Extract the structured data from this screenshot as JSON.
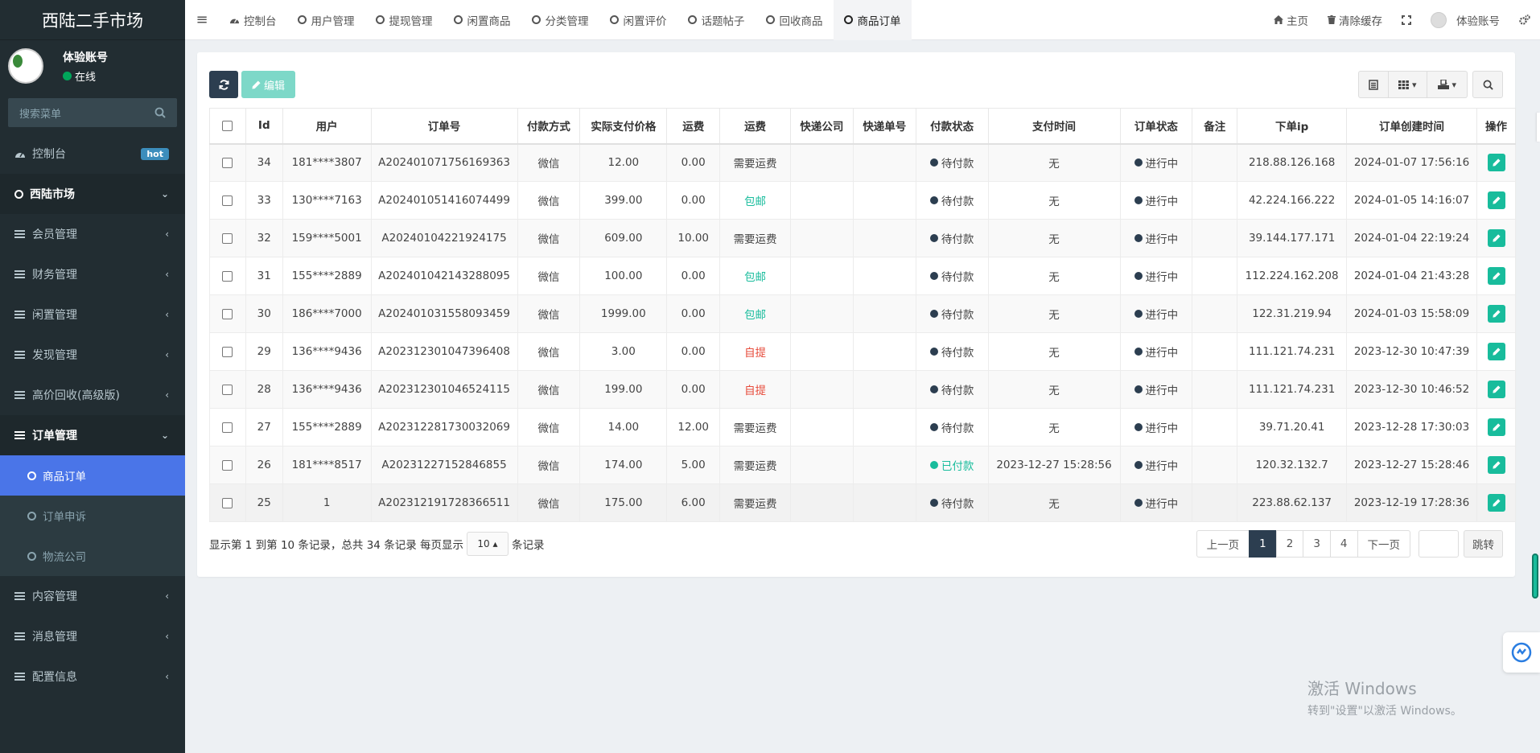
{
  "app_title": "西陆二手市场",
  "user": {
    "name": "体验账号",
    "status": "在线"
  },
  "sidebar": {
    "search_placeholder": "搜索菜单",
    "items": [
      {
        "label": "控制台",
        "badge": "hot"
      },
      {
        "label": "西陆市场"
      },
      {
        "label": "会员管理"
      },
      {
        "label": "财务管理"
      },
      {
        "label": "闲置管理"
      },
      {
        "label": "发现管理"
      },
      {
        "label": "高价回收(高级版)"
      },
      {
        "label": "订单管理"
      },
      {
        "label": "商品订单"
      },
      {
        "label": "订单申诉"
      },
      {
        "label": "物流公司"
      },
      {
        "label": "内容管理"
      },
      {
        "label": "消息管理"
      },
      {
        "label": "配置信息"
      }
    ]
  },
  "tabs": [
    "控制台",
    "用户管理",
    "提现管理",
    "闲置商品",
    "分类管理",
    "闲置评价",
    "话题帖子",
    "回收商品",
    "商品订单"
  ],
  "topbar_right": {
    "home": "主页",
    "clear_cache": "清除缓存",
    "account": "体验账号"
  },
  "toolbar": {
    "edit_label": "编辑"
  },
  "table": {
    "headers": [
      "Id",
      "用户",
      "订单号",
      "付款方式",
      "实际支付价格",
      "运费",
      "运费",
      "快递公司",
      "快递单号",
      "付款状态",
      "支付时间",
      "订单状态",
      "备注",
      "下单ip",
      "订单创建时间",
      "操作"
    ],
    "rows": [
      {
        "id": "34",
        "user": "181****3807",
        "order_no": "A202401071756169363",
        "pay_method": "微信",
        "price": "12.00",
        "freight": "0.00",
        "freight_type": "需要运费",
        "freight_color": "normal",
        "pay_status": "待付款",
        "pay_status_color": "normal",
        "pay_time": "无",
        "order_status": "进行中",
        "ip": "218.88.126.168",
        "created": "2024-01-07 17:56:16"
      },
      {
        "id": "33",
        "user": "130****7163",
        "order_no": "A202401051416074499",
        "pay_method": "微信",
        "price": "399.00",
        "freight": "0.00",
        "freight_type": "包邮",
        "freight_color": "green",
        "pay_status": "待付款",
        "pay_status_color": "normal",
        "pay_time": "无",
        "order_status": "进行中",
        "ip": "42.224.166.222",
        "created": "2024-01-05 14:16:07"
      },
      {
        "id": "32",
        "user": "159****5001",
        "order_no": "A20240104221924175",
        "pay_method": "微信",
        "price": "609.00",
        "freight": "10.00",
        "freight_type": "需要运费",
        "freight_color": "normal",
        "pay_status": "待付款",
        "pay_status_color": "normal",
        "pay_time": "无",
        "order_status": "进行中",
        "ip": "39.144.177.171",
        "created": "2024-01-04 22:19:24"
      },
      {
        "id": "31",
        "user": "155****2889",
        "order_no": "A202401042143288095",
        "pay_method": "微信",
        "price": "100.00",
        "freight": "0.00",
        "freight_type": "包邮",
        "freight_color": "green",
        "pay_status": "待付款",
        "pay_status_color": "normal",
        "pay_time": "无",
        "order_status": "进行中",
        "ip": "112.224.162.208",
        "created": "2024-01-04 21:43:28"
      },
      {
        "id": "30",
        "user": "186****7000",
        "order_no": "A202401031558093459",
        "pay_method": "微信",
        "price": "1999.00",
        "freight": "0.00",
        "freight_type": "包邮",
        "freight_color": "green",
        "pay_status": "待付款",
        "pay_status_color": "normal",
        "pay_time": "无",
        "order_status": "进行中",
        "ip": "122.31.219.94",
        "created": "2024-01-03 15:58:09"
      },
      {
        "id": "29",
        "user": "136****9436",
        "order_no": "A202312301047396408",
        "pay_method": "微信",
        "price": "3.00",
        "freight": "0.00",
        "freight_type": "自提",
        "freight_color": "red",
        "pay_status": "待付款",
        "pay_status_color": "normal",
        "pay_time": "无",
        "order_status": "进行中",
        "ip": "111.121.74.231",
        "created": "2023-12-30 10:47:39"
      },
      {
        "id": "28",
        "user": "136****9436",
        "order_no": "A202312301046524115",
        "pay_method": "微信",
        "price": "199.00",
        "freight": "0.00",
        "freight_type": "自提",
        "freight_color": "red",
        "pay_status": "待付款",
        "pay_status_color": "normal",
        "pay_time": "无",
        "order_status": "进行中",
        "ip": "111.121.74.231",
        "created": "2023-12-30 10:46:52"
      },
      {
        "id": "27",
        "user": "155****2889",
        "order_no": "A202312281730032069",
        "pay_method": "微信",
        "price": "14.00",
        "freight": "12.00",
        "freight_type": "需要运费",
        "freight_color": "normal",
        "pay_status": "待付款",
        "pay_status_color": "normal",
        "pay_time": "无",
        "order_status": "进行中",
        "ip": "39.71.20.41",
        "created": "2023-12-28 17:30:03"
      },
      {
        "id": "26",
        "user": "181****8517",
        "order_no": "A20231227152846855",
        "pay_method": "微信",
        "price": "174.00",
        "freight": "5.00",
        "freight_type": "需要运费",
        "freight_color": "normal",
        "pay_status": "已付款",
        "pay_status_color": "green",
        "pay_time": "2023-12-27 15:28:56",
        "order_status": "进行中",
        "ip": "120.32.132.7",
        "created": "2023-12-27 15:28:46"
      },
      {
        "id": "25",
        "user": "1",
        "order_no": "A202312191728366511",
        "pay_method": "微信",
        "price": "175.00",
        "freight": "6.00",
        "freight_type": "需要运费",
        "freight_color": "normal",
        "pay_status": "待付款",
        "pay_status_color": "normal",
        "pay_time": "无",
        "order_status": "进行中",
        "ip": "223.88.62.137",
        "created": "2023-12-19 17:28:36"
      }
    ]
  },
  "pagination": {
    "summary_prefix": "显示第 1 到第 10 条记录，总共 34 条记录 每页显示",
    "page_size": "10",
    "summary_suffix": "条记录",
    "prev": "上一页",
    "pages": [
      "1",
      "2",
      "3",
      "4"
    ],
    "current_page": "1",
    "next": "下一页",
    "jump": "跳转"
  },
  "watermark": {
    "line1": "激活 Windows",
    "line2": "转到\"设置\"以激活 Windows。"
  },
  "colors": {
    "sidebar_bg": "#222d32",
    "active_blue": "#4a75e8",
    "primary_dark": "#2c3e50",
    "success": "#18bc9c",
    "danger": "#e74c3c",
    "hot_badge": "#3c8dbc"
  }
}
